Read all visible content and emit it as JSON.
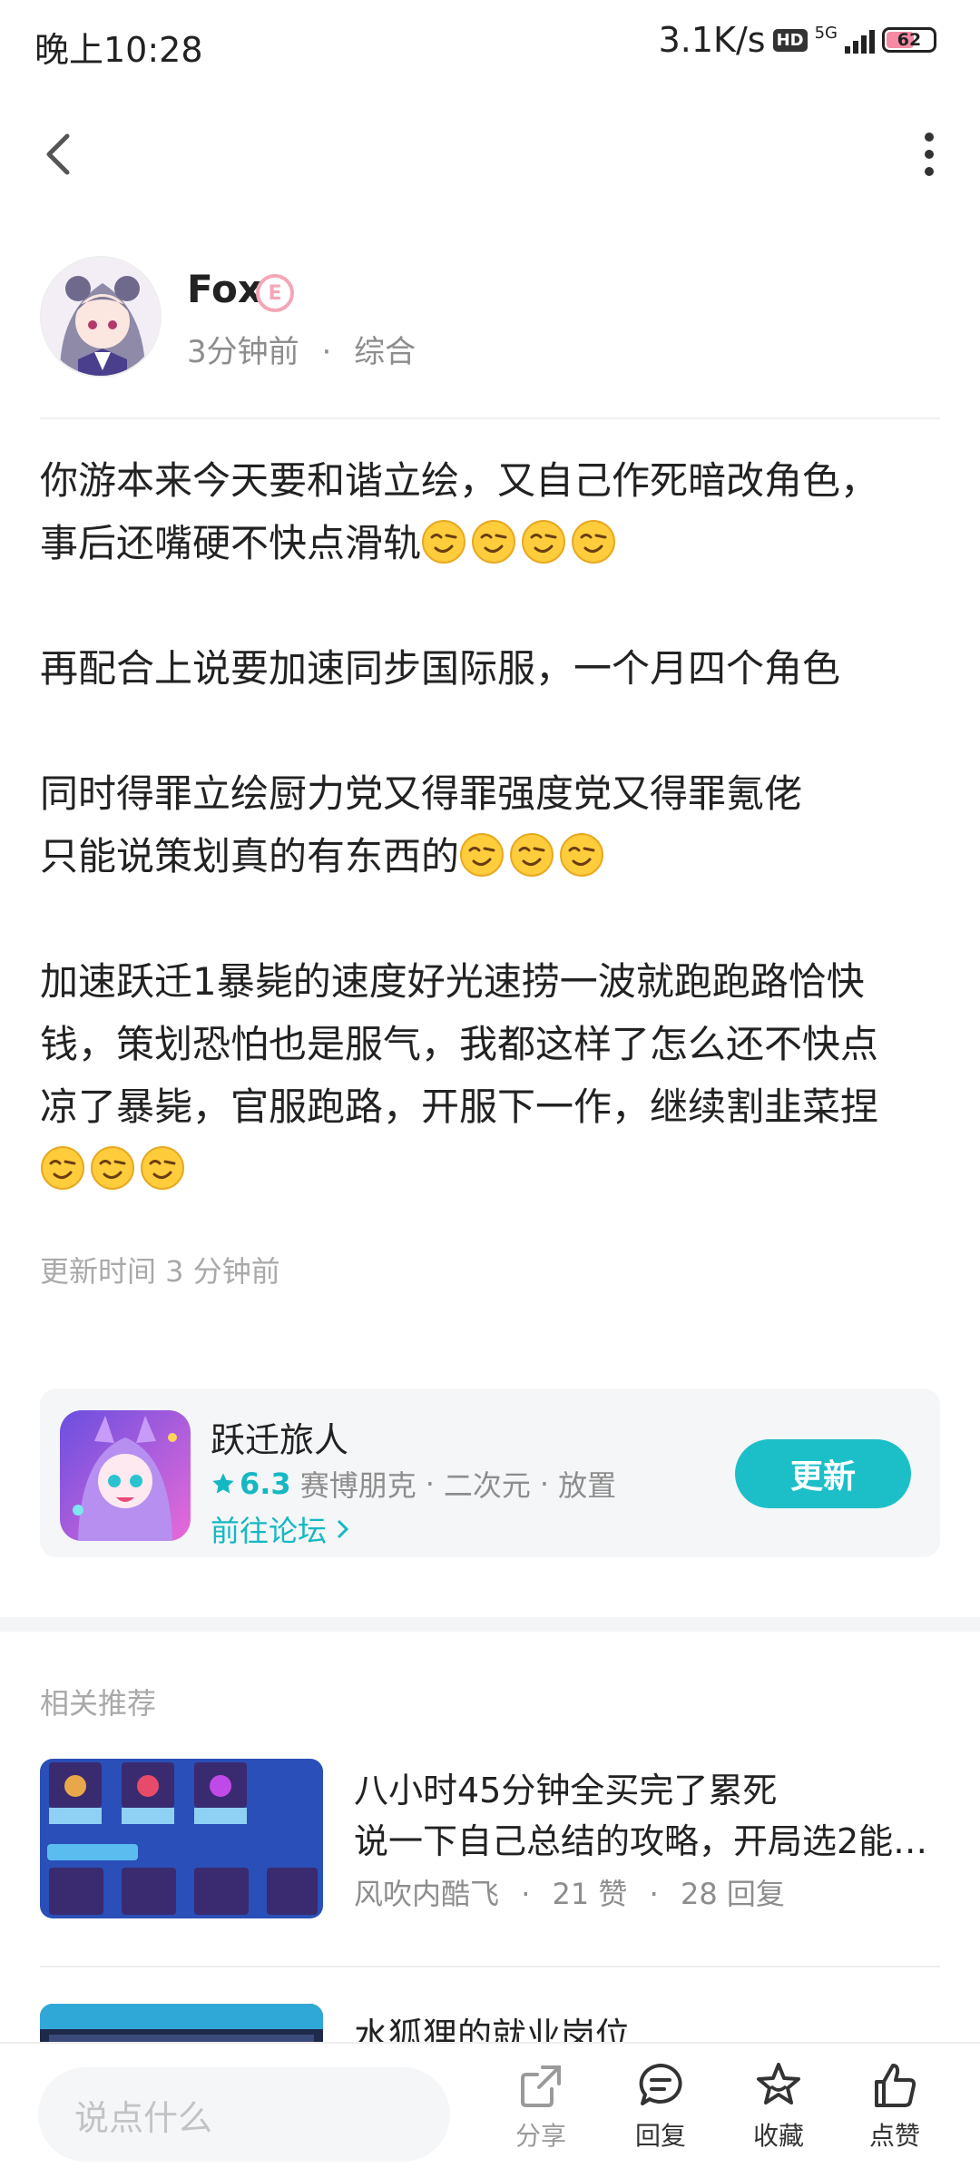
{
  "status_bar": {
    "time": "晚上10:28",
    "net_speed": "3.1K/s",
    "hd": "HD",
    "net_type": "5G",
    "battery": "62"
  },
  "author": {
    "name": "Fox",
    "badge": "E",
    "time_ago": "3分钟前",
    "separator": "·",
    "category": "综合"
  },
  "post": {
    "paragraphs": [
      {
        "lines": [
          {
            "text": "你游本来今天要和谐立绘，又自己作死暗改角色，",
            "emoji_count": 0
          },
          {
            "text": "事后还嘴硬不快点滑轨",
            "emoji_count": 4
          }
        ]
      },
      {
        "lines": [
          {
            "text": "再配合上说要加速同步国际服，一个月四个角色",
            "emoji_count": 0
          }
        ]
      },
      {
        "lines": [
          {
            "text": "同时得罪立绘厨力党又得罪强度党又得罪氪佬",
            "emoji_count": 0
          },
          {
            "text": "只能说策划真的有东西的",
            "emoji_count": 3
          }
        ]
      },
      {
        "lines": [
          {
            "text": "加速跃迁1暴毙的速度好光速捞一波就跑跑路恰快",
            "emoji_count": 0
          },
          {
            "text": "钱，策划恐怕也是服气，我都这样了怎么还不快点",
            "emoji_count": 0
          },
          {
            "text": "凉了暴毙，官服跑路，开服下一作，继续割韭菜捏",
            "emoji_count": 0
          },
          {
            "text": "",
            "emoji_count": 3
          }
        ]
      }
    ],
    "emoji_name": "wink-emoji",
    "update_time": "更新时间 3 分钟前"
  },
  "game_card": {
    "name": "跃迁旅人",
    "rating": "6.3",
    "tags": [
      "赛博朋克",
      "二次元",
      "放置"
    ],
    "tag_separator": "·",
    "forum_link": "前往论坛",
    "update_button": "更新",
    "accent_color": "#1cbfc8"
  },
  "related": {
    "title": "相关推荐",
    "items": [
      {
        "title": "八小时45分钟全买完了累死",
        "excerpt": "说一下自己总结的攻略，开局选2能…",
        "author": "风吹内酷飞",
        "likes": "21 赞",
        "replies": "28 回复",
        "separator": "·"
      },
      {
        "title": "水狐狸的就业岗位",
        "excerpt": "",
        "author": "",
        "likes": "",
        "replies": "",
        "separator": ""
      }
    ]
  },
  "bottom_bar": {
    "comment_placeholder": "说点什么",
    "actions": [
      {
        "label": "分享",
        "icon": "share-icon"
      },
      {
        "label": "回复",
        "icon": "comment-icon"
      },
      {
        "label": "收藏",
        "icon": "star-icon"
      },
      {
        "label": "点赞",
        "icon": "thumbs-up-icon"
      }
    ]
  }
}
